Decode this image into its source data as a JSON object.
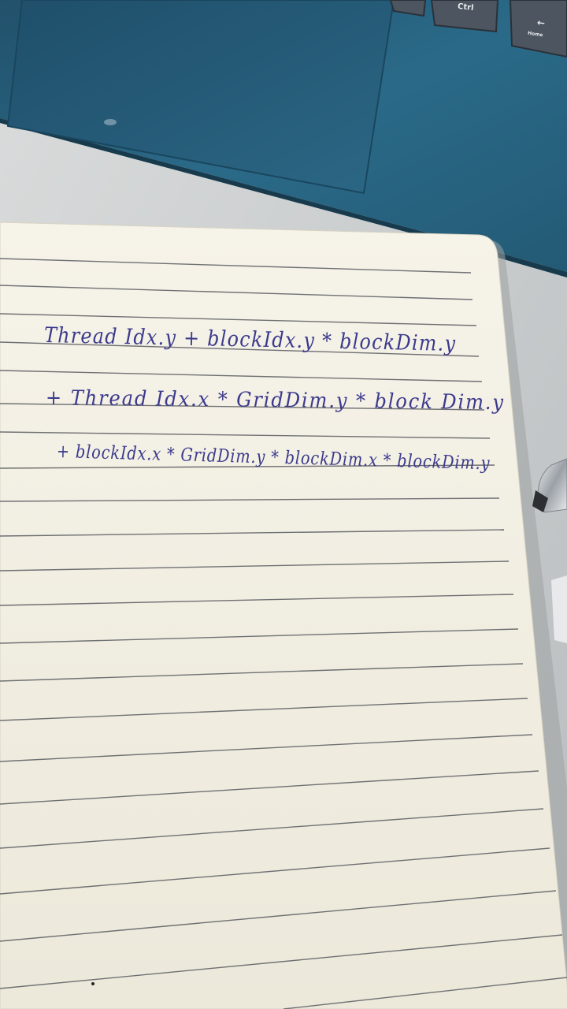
{
  "laptop": {
    "keys": {
      "ctrl_label": "Ctrl",
      "home_label": "Home",
      "home_arrow": "←"
    }
  },
  "notebook": {
    "ink_color": "#3b3a8c",
    "paper_color": "#f4f1e6",
    "rule_color": "#77787c",
    "handwritten_lines": [
      "Thread Idx.y + blockIdx.y * blockDim.y",
      "+ Thread Idx.x * GridDim.y * block Dim.y",
      "+ blockIdx.x * GridDim.y * blockDim.x * blockDim.y"
    ]
  },
  "colors": {
    "laptop_body": "#26627f",
    "desk": "#cfd3d4"
  }
}
